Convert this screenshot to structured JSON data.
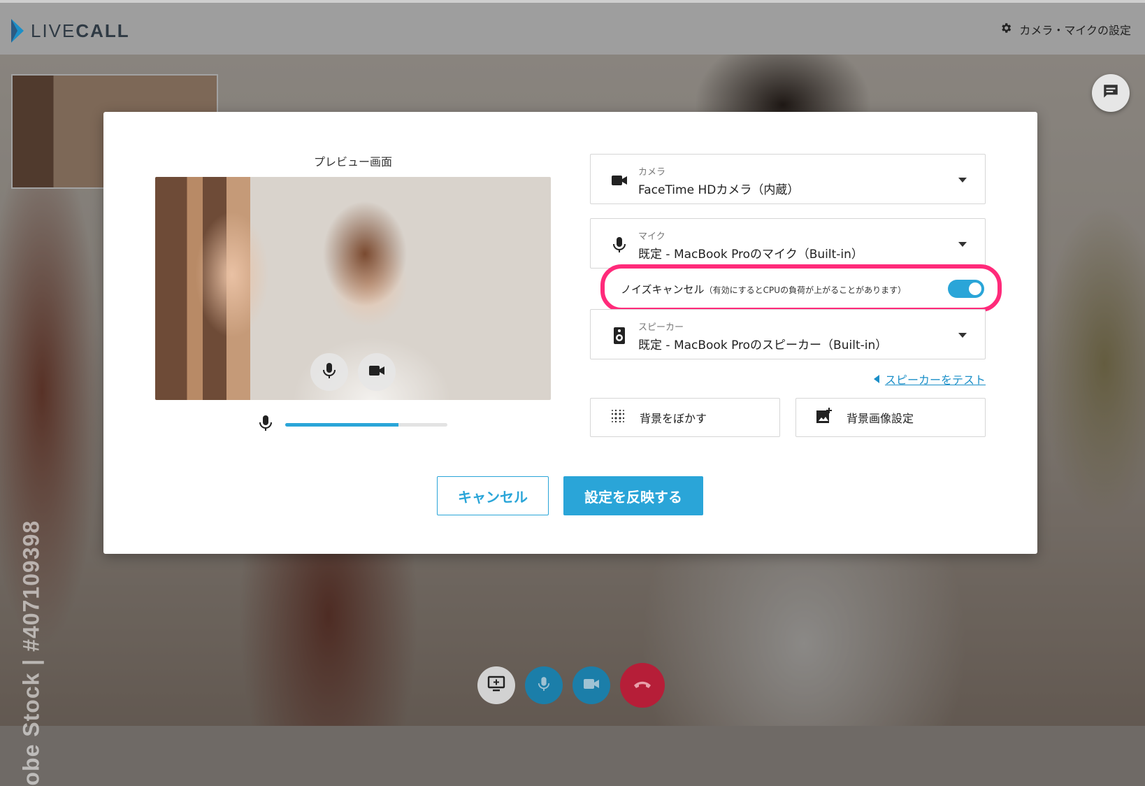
{
  "header": {
    "logo_light": "LIVE",
    "logo_bold": "CALL",
    "settings_label": "カメラ・マイクの設定"
  },
  "background": {
    "watermark": "obe Stock | #407109398"
  },
  "modal": {
    "preview_title": "プレビュー画面",
    "mic_level_fraction": 0.7,
    "camera": {
      "label": "カメラ",
      "value": "FaceTime HDカメラ（内蔵）"
    },
    "mic": {
      "label": "マイク",
      "value": "既定 - MacBook Proのマイク（Built-in）"
    },
    "noise_cancel": {
      "label": "ノイズキャンセル",
      "note": "（有効にするとCPUの負荷が上がることがあります）",
      "enabled": true
    },
    "speaker": {
      "label": "スピーカー",
      "value": "既定 - MacBook Proのスピーカー（Built-in）"
    },
    "speaker_test_label": "スピーカーをテスト",
    "blur_label": "背景をぼかす",
    "bg_image_label": "背景画像設定",
    "cancel_label": "キャンセル",
    "apply_label": "設定を反映する"
  },
  "colors": {
    "accent": "#2aa5d8",
    "highlight": "#ff2a7a",
    "hangup": "#b61e38"
  },
  "icons": {
    "settings": "gear-icon",
    "chat": "chat-icon",
    "camera": "videocam-icon",
    "mic": "mic-icon",
    "speaker": "speaker-icon",
    "blur": "blur-icon",
    "bg_image": "add-photo-icon",
    "screen_share": "screen-share-icon",
    "hangup": "call-end-icon"
  }
}
